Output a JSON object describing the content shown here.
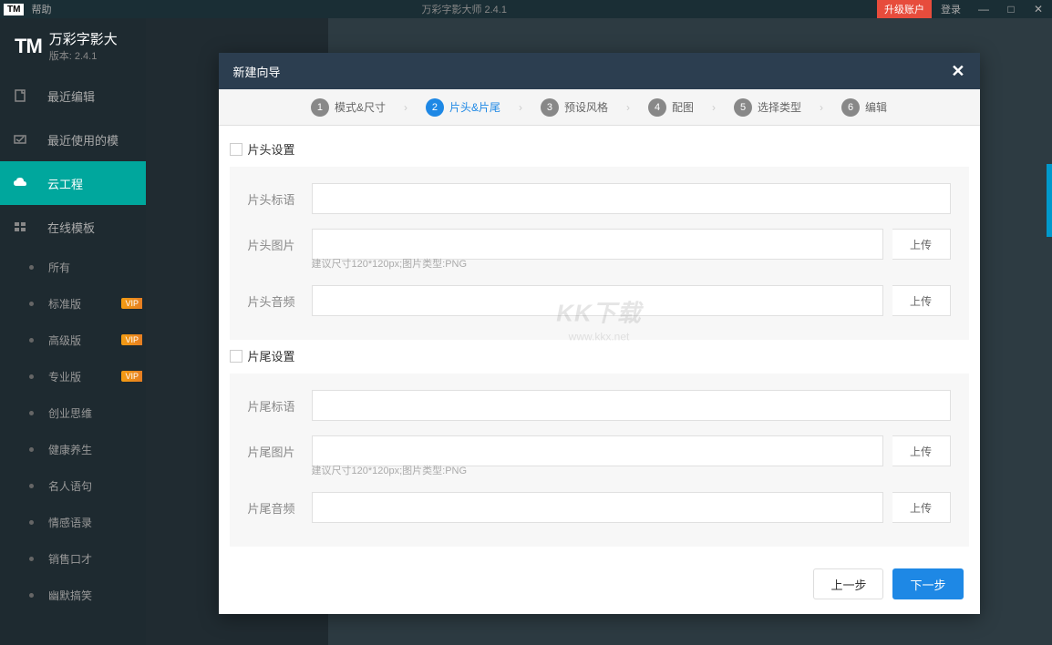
{
  "titlebar": {
    "tm": "TM",
    "help": "帮助",
    "center": "万彩字影大师 2.4.1",
    "upgrade": "升级账户",
    "login": "登录"
  },
  "sidebar": {
    "logo": "TM",
    "app_name": "万彩字影大",
    "version": "版本: 2.4.1",
    "items": [
      {
        "label": "最近编辑",
        "icon": "recent"
      },
      {
        "label": "最近使用的模",
        "icon": "template-recent"
      },
      {
        "label": "云工程",
        "icon": "cloud",
        "active": true
      },
      {
        "label": "在线模板",
        "icon": "grid"
      }
    ],
    "sub_items": [
      {
        "label": "所有",
        "vip": false
      },
      {
        "label": "标准版",
        "vip": true
      },
      {
        "label": "高级版",
        "vip": true
      },
      {
        "label": "专业版",
        "vip": true
      },
      {
        "label": "创业思维",
        "vip": false
      },
      {
        "label": "健康养生",
        "vip": false
      },
      {
        "label": "名人语句",
        "vip": false
      },
      {
        "label": "情感语录",
        "vip": false
      },
      {
        "label": "销售口才",
        "vip": false
      },
      {
        "label": "幽默搞笑",
        "vip": false
      }
    ],
    "vip_text": "VIP"
  },
  "modal": {
    "title": "新建向导",
    "steps": [
      {
        "num": "1",
        "label": "模式&尺寸"
      },
      {
        "num": "2",
        "label": "片头&片尾"
      },
      {
        "num": "3",
        "label": "预设风格"
      },
      {
        "num": "4",
        "label": "配图"
      },
      {
        "num": "5",
        "label": "选择类型"
      },
      {
        "num": "6",
        "label": "编辑"
      }
    ],
    "opening": {
      "title": "片头设置",
      "slogan_label": "片头标语",
      "image_label": "片头图片",
      "image_hint": "建议尺寸120*120px;图片类型:PNG",
      "audio_label": "片头音频",
      "upload": "上传"
    },
    "ending": {
      "title": "片尾设置",
      "slogan_label": "片尾标语",
      "image_label": "片尾图片",
      "image_hint": "建议尺寸120*120px;图片类型:PNG",
      "audio_label": "片尾音频",
      "upload": "上传"
    },
    "prev": "上一步",
    "next": "下一步"
  },
  "watermark": {
    "main": "KK下载",
    "sub": "www.kkx.net"
  }
}
